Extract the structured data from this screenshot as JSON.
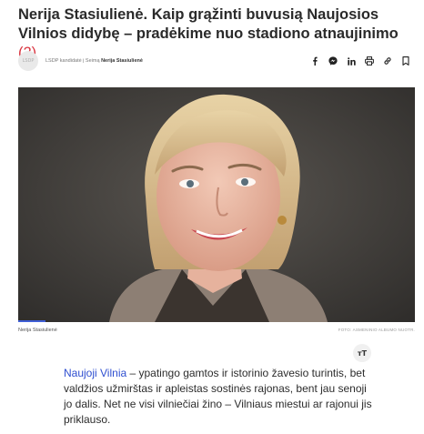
{
  "article": {
    "title": "Nerija Stasiulienė. Kaip grąžinti buvusią Naujosios Vilnios didybę – pradėkime nuo stadiono atnaujinimo",
    "comment_count": "(2)"
  },
  "byline": {
    "avatar_text": "LSDP",
    "author_prefix": "LSDP kandidatė į Seimą",
    "author_name": "Nerija Stasiulienė"
  },
  "share": {
    "icons": [
      "facebook-icon",
      "messenger-icon",
      "linkedin-icon",
      "print-icon",
      "link-icon",
      "bookmark-icon"
    ]
  },
  "photo": {
    "caption": "Nerija Stasiulienė",
    "credit": "FOTO: ASMENINIO ALBUMO NUOTR."
  },
  "textsize": {
    "label": "ᴛT"
  },
  "lead": {
    "link_text": "Naujoji Vilnia",
    "text": " – ypatingo gamtos ir istorinio žavesio turintis, bet valdžios užmirštas ir apleistas sostinės rajonas, bent jau senoji jo dalis. Net ne visi vilniečiai žino – Vilniaus miestui ar rajonui jis priklauso."
  },
  "colors": {
    "accent": "#3f5fd6",
    "link": "#2f4fd0",
    "comment_count": "#d9343f"
  }
}
